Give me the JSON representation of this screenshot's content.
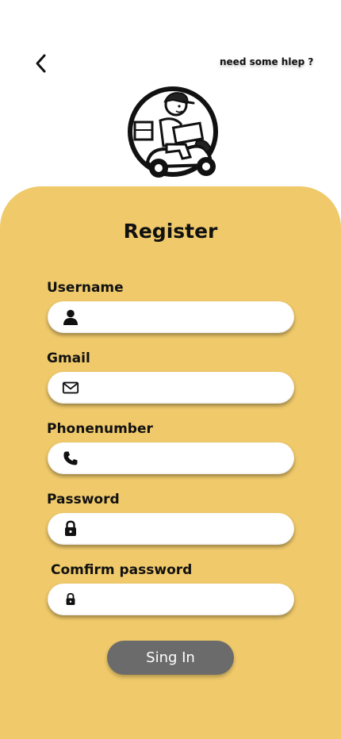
{
  "header": {
    "back_icon": "chevron-left-icon",
    "help_link": "need some hlep ?"
  },
  "logo": {
    "icon": "delivery-scooter-logo"
  },
  "form": {
    "title": "Register",
    "fields": [
      {
        "label": "Username",
        "icon": "user-icon",
        "value": "",
        "placeholder": ""
      },
      {
        "label": "Gmail",
        "icon": "mail-icon",
        "value": "",
        "placeholder": ""
      },
      {
        "label": "Phonenumber",
        "icon": "phone-icon",
        "value": "",
        "placeholder": ""
      },
      {
        "label": "Password",
        "icon": "lock-icon",
        "value": "",
        "placeholder": ""
      },
      {
        "label": "Comfirm password",
        "icon": "lock-icon",
        "value": "",
        "placeholder": ""
      }
    ],
    "submit_label": "Sing In"
  },
  "colors": {
    "card_background": "#efc96a",
    "button_background": "#6b6b6b",
    "field_background": "#ffffff"
  }
}
